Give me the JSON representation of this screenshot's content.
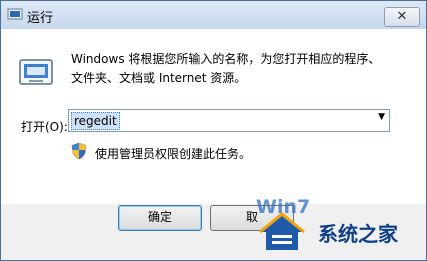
{
  "window": {
    "title": "运行",
    "close_glyph": "✕"
  },
  "dialog": {
    "description_lines": [
      "Windows 将根据您所输入的名称，为您打开相应的程序、",
      "文件夹、文档或 Internet 资源。"
    ],
    "open_label": "打开(O):",
    "command_value": "regedit",
    "admin_notice": "使用管理员权限创建此任务。"
  },
  "buttons": {
    "ok": "确定",
    "cancel": "取"
  },
  "watermark": {
    "brand": "系统之家",
    "overlay": "Win7"
  },
  "icons": {
    "title": "run-icon",
    "main": "run-program-icon",
    "shield": "uac-shield-icon",
    "dropdown": "dropdown-arrow-icon"
  },
  "colors": {
    "accent": "#3c7fb1",
    "selection": "#cfe1f7",
    "watermark": "#0f3f86"
  }
}
